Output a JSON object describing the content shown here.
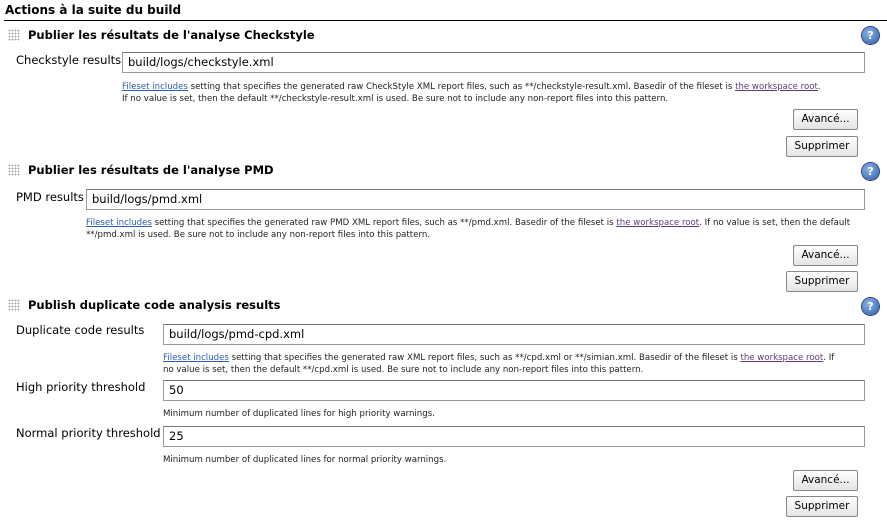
{
  "section_title": "Actions à la suite du build",
  "common": {
    "fileset_link": "Fileset includes",
    "workspace_link": "the workspace root",
    "advanced": "Avancé...",
    "delete": "Supprimer",
    "help": "?"
  },
  "checkstyle": {
    "title": "Publier les résultats de l'analyse Checkstyle",
    "label": "Checkstyle results",
    "value": "build/logs/checkstyle.xml",
    "help1": " setting that specifies the generated raw CheckStyle XML report files, such as **/checkstyle-result.xml. Basedir of the fileset is ",
    "help2": "If no value is set, then the default **/checkstyle-result.xml is used. Be sure not to include any non-report files into this pattern."
  },
  "pmd": {
    "title": "Publier les résultats de l'analyse PMD",
    "label": "PMD results",
    "value": "build/logs/pmd.xml",
    "help1": " setting that specifies the generated raw PMD XML report files, such as **/pmd.xml. Basedir of the fileset is ",
    "help2": ". If no value is set, then the default **/pmd.xml is used. Be sure not to include any non-report files into this pattern."
  },
  "dup": {
    "title": "Publish duplicate code analysis results",
    "label": "Duplicate code results",
    "value": "build/logs/pmd-cpd.xml",
    "help1": " setting that specifies the generated raw XML report files, such as **/cpd.xml or **/simian.xml. Basedir of the fileset is ",
    "help2": ". If no value is set, then the default **/cpd.xml is used. Be sure not to include any non-report files into this pattern.",
    "high_label": "High priority threshold",
    "high_value": "50",
    "high_desc": "Minimum number of duplicated lines for high priority warnings.",
    "normal_label": "Normal priority threshold",
    "normal_value": "25",
    "normal_desc": "Minimum number of duplicated lines for normal priority warnings."
  }
}
